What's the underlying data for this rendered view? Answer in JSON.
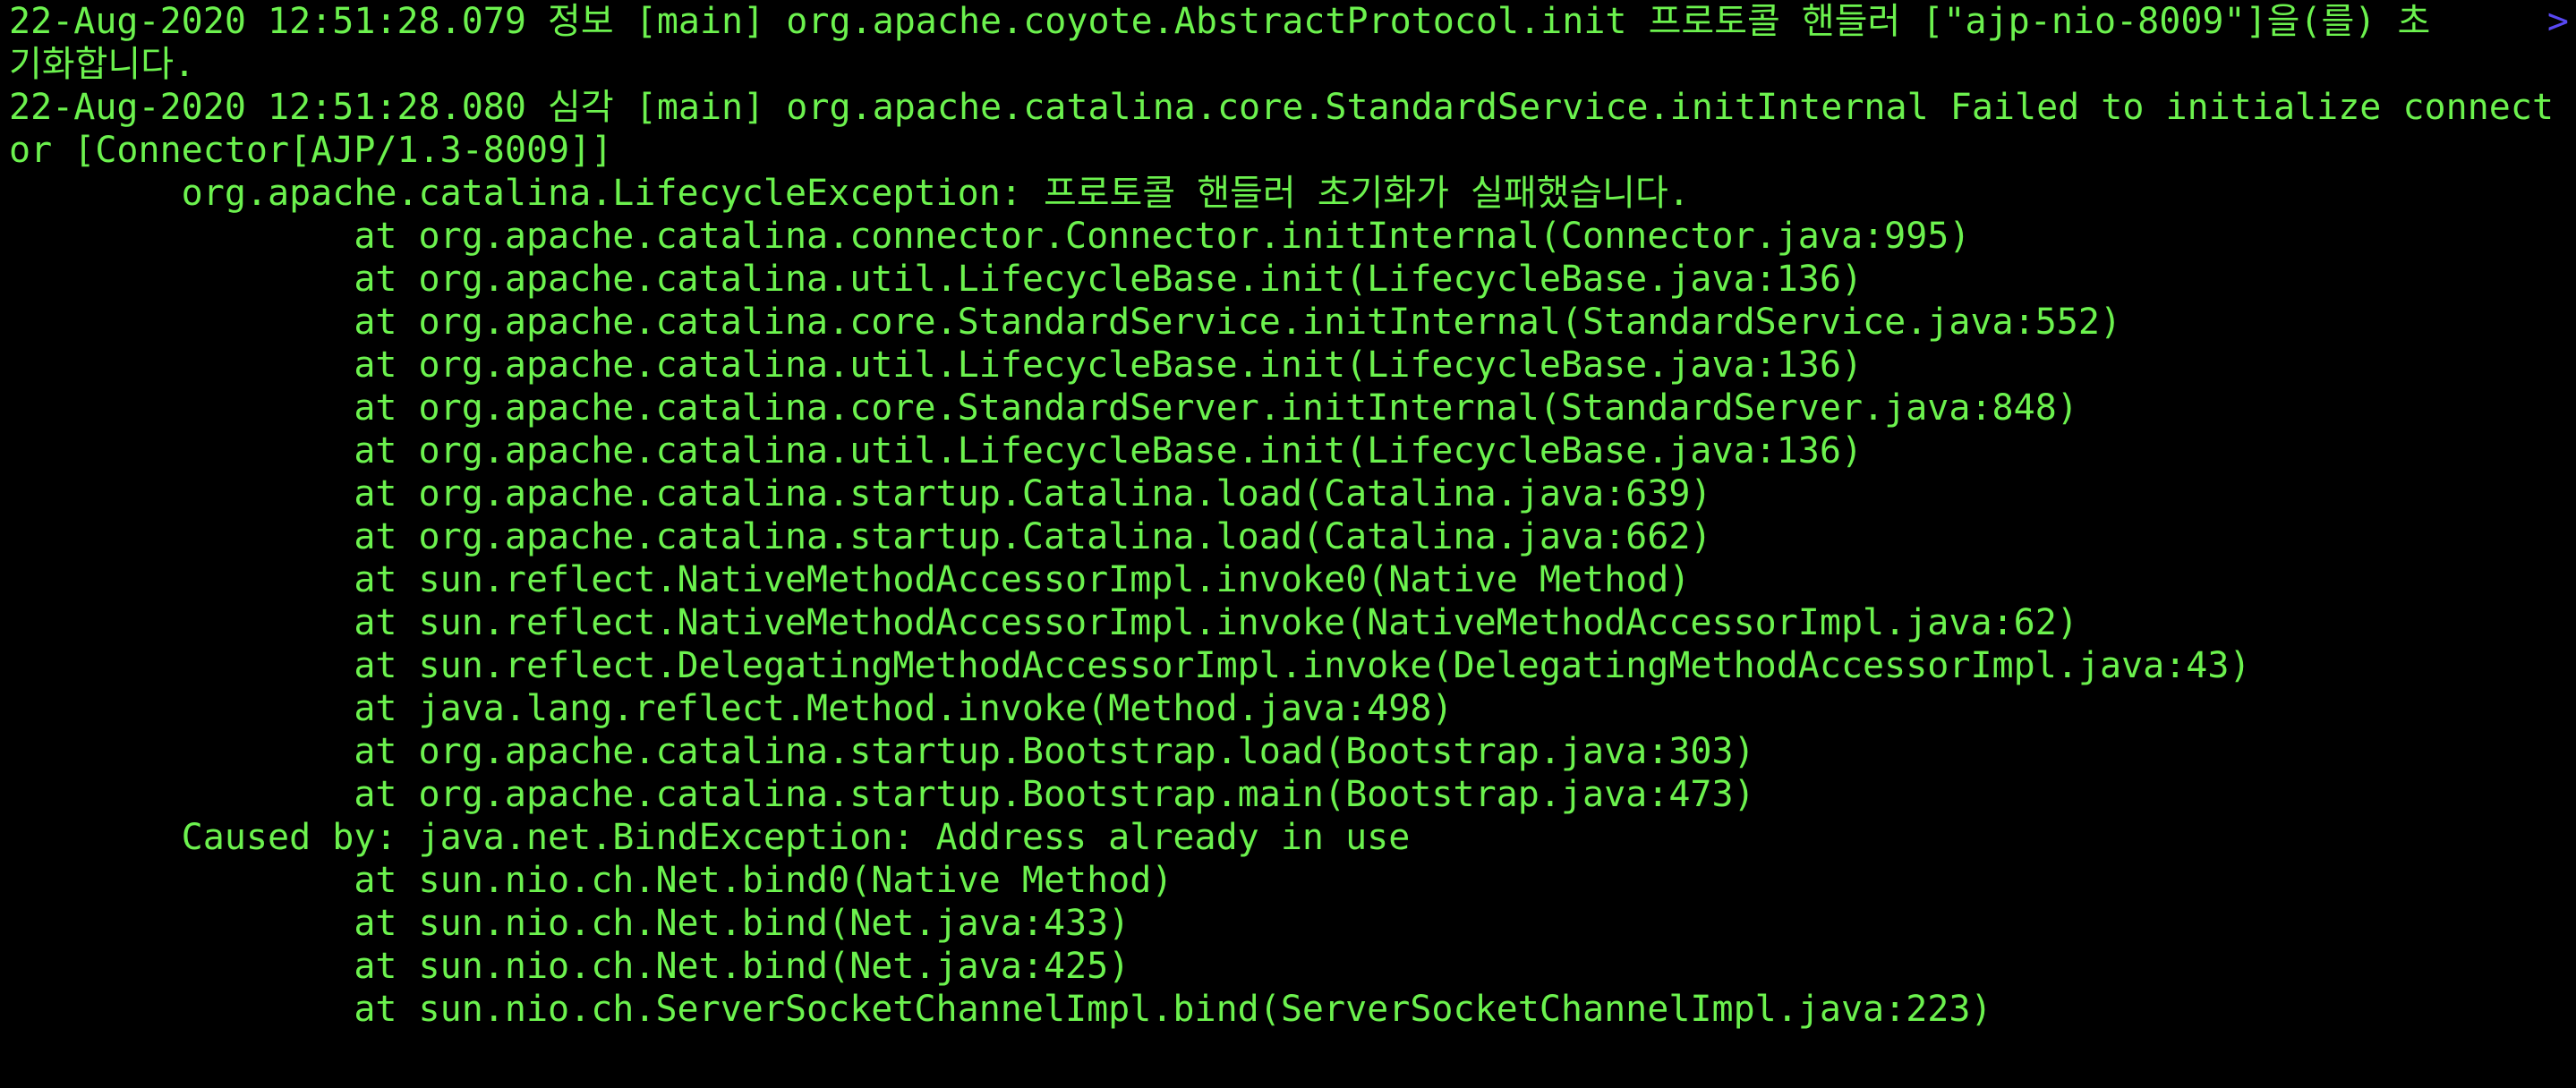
{
  "colors": {
    "text": "#6cf24e",
    "background": "#000000",
    "wrap_marker": "#5848f2"
  },
  "wrap_marker": ">",
  "lines": [
    "22-Aug-2020 12:51:28.079 정보 [main] org.apache.coyote.AbstractProtocol.init 프로토콜 핸들러 [\"ajp-nio-8009\"]을(를) 초",
    "기화합니다.",
    "22-Aug-2020 12:51:28.080 심각 [main] org.apache.catalina.core.StandardService.initInternal Failed to initialize connect",
    "or [Connector[AJP/1.3-8009]]",
    "        org.apache.catalina.LifecycleException: 프로토콜 핸들러 초기화가 실패했습니다.",
    "                at org.apache.catalina.connector.Connector.initInternal(Connector.java:995)",
    "                at org.apache.catalina.util.LifecycleBase.init(LifecycleBase.java:136)",
    "                at org.apache.catalina.core.StandardService.initInternal(StandardService.java:552)",
    "                at org.apache.catalina.util.LifecycleBase.init(LifecycleBase.java:136)",
    "                at org.apache.catalina.core.StandardServer.initInternal(StandardServer.java:848)",
    "                at org.apache.catalina.util.LifecycleBase.init(LifecycleBase.java:136)",
    "                at org.apache.catalina.startup.Catalina.load(Catalina.java:639)",
    "                at org.apache.catalina.startup.Catalina.load(Catalina.java:662)",
    "                at sun.reflect.NativeMethodAccessorImpl.invoke0(Native Method)",
    "                at sun.reflect.NativeMethodAccessorImpl.invoke(NativeMethodAccessorImpl.java:62)",
    "                at sun.reflect.DelegatingMethodAccessorImpl.invoke(DelegatingMethodAccessorImpl.java:43)",
    "                at java.lang.reflect.Method.invoke(Method.java:498)",
    "                at org.apache.catalina.startup.Bootstrap.load(Bootstrap.java:303)",
    "                at org.apache.catalina.startup.Bootstrap.main(Bootstrap.java:473)",
    "        Caused by: java.net.BindException: Address already in use",
    "                at sun.nio.ch.Net.bind0(Native Method)",
    "                at sun.nio.ch.Net.bind(Net.java:433)",
    "                at sun.nio.ch.Net.bind(Net.java:425)",
    "                at sun.nio.ch.ServerSocketChannelImpl.bind(ServerSocketChannelImpl.java:223)"
  ]
}
